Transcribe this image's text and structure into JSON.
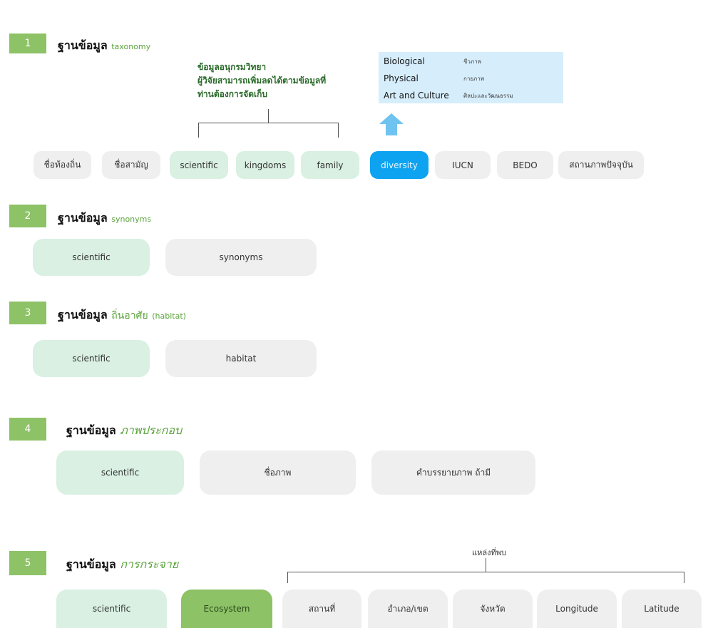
{
  "sections": [
    {
      "number": "1",
      "title": "ฐานข้อมูล",
      "subtitle": "taxonomy",
      "note_lines": [
        "ข้อมูลอนุกรมวิทยา",
        "ผู้วิจัยสามารถเพิ่มลดได้ตามข้อมูลที่",
        "ท่านต้องการจัดเก็บ"
      ],
      "diversity_info": [
        {
          "label": "Biological",
          "desc": "ชีวภาพ"
        },
        {
          "label": "Physical",
          "desc": "กายภาพ"
        },
        {
          "label": "Art and Culture",
          "desc": "ศิลปะและวัฒนธรรม"
        }
      ],
      "fields": [
        "ชื่อท้องถิ่น",
        "ชื่อสามัญ",
        "scientific",
        "kingdoms",
        "family",
        "diversity",
        "IUCN",
        "BEDO",
        "สถานภาพปัจจุบัน"
      ]
    },
    {
      "number": "2",
      "title": "ฐานข้อมูล",
      "subtitle": "synonyms",
      "fields": [
        "scientific",
        "synonyms"
      ]
    },
    {
      "number": "3",
      "title": "ฐานข้อมูล",
      "subtitle": "ถิ่นอาศัย",
      "subtitle_extra": "(habitat)",
      "fields": [
        "scientific",
        "habitat"
      ]
    },
    {
      "number": "4",
      "title": "ฐานข้อมูล",
      "subtitle": "ภาพประกอบ",
      "fields": [
        "scientific",
        "ชื่อภาพ",
        "คำบรรยายภาพ ถ้ามี"
      ]
    },
    {
      "number": "5",
      "title": "ฐานข้อมูล",
      "subtitle": "การกระจาย",
      "group_label": "แหล่งที่พบ",
      "fields": [
        "scientific",
        "Ecosystem",
        "สถานที่",
        "อำเภอ/เขต",
        "จังหวัด",
        "Longitude",
        "Latitude"
      ]
    }
  ],
  "colors": {
    "number_badge": "#8dc266",
    "subtitle_green": "#5aa33b",
    "mint_field": "#d9f0e2",
    "grey_field": "#efefef",
    "diversity_blue": "#0ea3f0",
    "info_box": "#d6eefc",
    "ecosystem_green": "#8dc266",
    "arrow": "#6fc3f0"
  }
}
